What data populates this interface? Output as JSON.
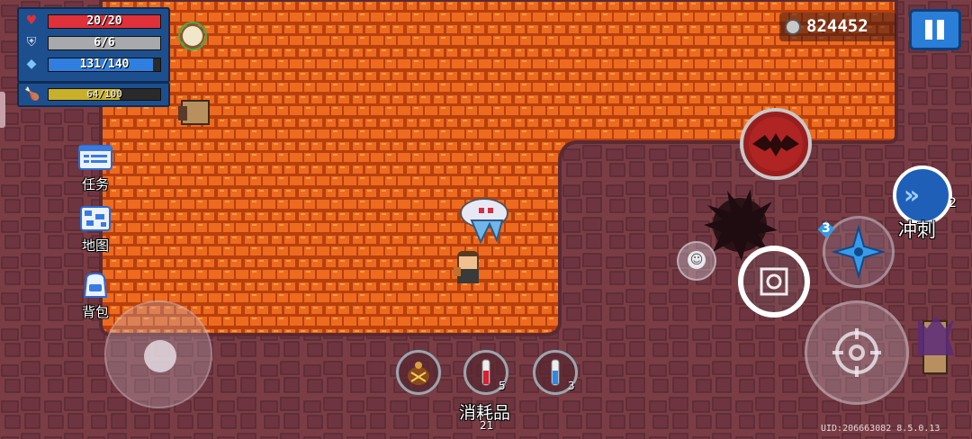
{
  "hud": {
    "health": {
      "current": 20,
      "max": 20,
      "text": "20/20",
      "color": "#e0303a",
      "icon": "heart-icon"
    },
    "armor": {
      "current": 6,
      "max": 6,
      "text": "6/6",
      "color": "#a7a9ac",
      "icon": "shield-icon"
    },
    "energy": {
      "current": 131,
      "max": 140,
      "text": "131/140",
      "color": "#2f7fe0",
      "icon": "energy-crystal-icon"
    },
    "hunger": {
      "current": 64,
      "max": 100,
      "text": "64/100",
      "color": "#c8b02a",
      "icon": "drumstick-icon"
    }
  },
  "side_menu": [
    {
      "label": "任务",
      "icon": "quest-board-icon"
    },
    {
      "label": "地图",
      "icon": "map-icon"
    },
    {
      "label": "背包",
      "icon": "backpack-icon"
    }
  ],
  "coins": {
    "value": "824452",
    "icon": "coin-icon"
  },
  "skills": {
    "dash_label": "冲刺",
    "dash_charges": "2",
    "shuriken_count": "3"
  },
  "consumables": {
    "label": "消耗品",
    "count": "21",
    "items": [
      {
        "name": "bomb-pouch",
        "count": ""
      },
      {
        "name": "red-potion",
        "count": "5"
      },
      {
        "name": "blue-potion",
        "count": "3"
      }
    ]
  },
  "footer": {
    "uid_version": "UID:206663082 8.5.0.13"
  },
  "colors": {
    "lava": "#e8621a",
    "lava_dark": "#b8400e",
    "ground": "#7a3d45",
    "ground_dark": "#5e2a33"
  }
}
